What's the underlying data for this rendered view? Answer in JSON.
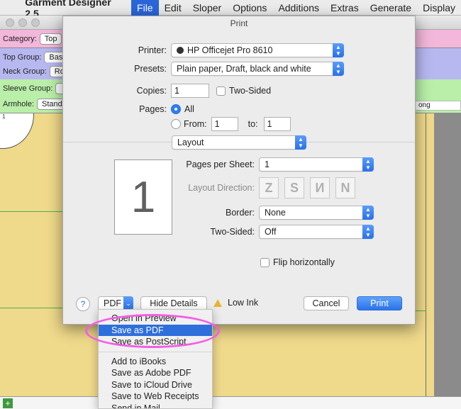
{
  "menubar": {
    "app": "Garment Designer 2.5",
    "items": [
      "File",
      "Edit",
      "Sloper",
      "Options",
      "Additions",
      "Extras",
      "Generate",
      "Display"
    ],
    "active": "File"
  },
  "app": {
    "category_label": "Category:",
    "category_value": "Top",
    "top_group_label": "Top Group:",
    "top_group_value": "Bas",
    "neck_group_label": "Neck Group:",
    "neck_group_value": "Ro",
    "sleeve_group_label": "Sleeve Group:",
    "armhole_label": "Armhole:",
    "armhole_value": "Stand",
    "right_field": "ong",
    "canvas_mark": "1"
  },
  "dialog": {
    "title": "Print",
    "printer_label": "Printer:",
    "printer_value": "HP Officejet Pro 8610",
    "presets_label": "Presets:",
    "presets_value": "Plain paper, Draft, black and white",
    "copies_label": "Copies:",
    "copies_value": "1",
    "two_sided_label": "Two-Sided",
    "pages_label": "Pages:",
    "all_label": "All",
    "from_label": "From:",
    "from_value": "1",
    "to_label": "to:",
    "to_value": "1",
    "section_value": "Layout",
    "preview_number": "1",
    "pages_per_sheet_label": "Pages per Sheet:",
    "pages_per_sheet_value": "1",
    "layout_direction_label": "Layout Direction:",
    "border_label": "Border:",
    "border_value": "None",
    "two_sided2_label": "Two-Sided:",
    "two_sided2_value": "Off",
    "flip_label": "Flip horizontally",
    "help": "?",
    "pdf_label": "PDF",
    "hide_details": "Hide Details",
    "low_ink": "Low Ink",
    "cancel": "Cancel",
    "print": "Print"
  },
  "pdf_menu": {
    "items": [
      "Open in Preview",
      "Save as PDF",
      "Save as PostScript",
      "Add to iBooks",
      "Save as Adobe PDF",
      "Save to iCloud Drive",
      "Save to Web Receipts",
      "Send in Mail"
    ],
    "highlighted": "Save as PDF"
  }
}
